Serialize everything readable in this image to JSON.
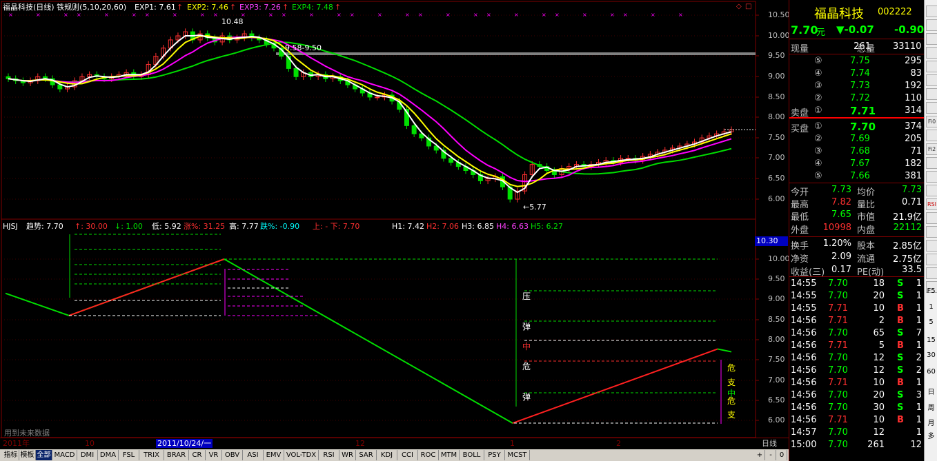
{
  "main_header": {
    "title": "福晶科技(日线) 铁规则(5,10,20,60)",
    "exp1": "EXP1: 7.61",
    "exp2": "EXP2: 7.46",
    "exp3": "EXP3: 7.26",
    "exp4": "EXP4: 7.48",
    "arrow_up": "↑"
  },
  "annotations": {
    "high": "10.48",
    "low": "←5.77",
    "resistance": "9.58-9.50",
    "no_future": "用到未来数据"
  },
  "yaxis_top": [
    "10.50",
    "10.00",
    "9.50",
    "9.00",
    "8.50",
    "8.00",
    "7.50",
    "7.00",
    "6.50",
    "6.00"
  ],
  "sub_header": {
    "name": "HJSJ",
    "trend": "趋势: 7.70",
    "t": "↑: 30.00",
    "l": "↓: 1.00",
    "low": "低: 5.92",
    "zhang": "涨%: 31.25",
    "high": "高: 7.77",
    "die": "跌%: -0.90",
    "updown": "上: - 下: 7.70",
    "h1": "H1: 7.42",
    "h2": "H2: 7.06",
    "h3": "H3: 6.85",
    "h4": "H4: 6.63",
    "h5": "H5: 6.27"
  },
  "yaxis_bottom": [
    "10.00",
    "9.50",
    "9.00",
    "8.50",
    "8.00",
    "7.50",
    "7.00",
    "6.50",
    "6.00"
  ],
  "sub_price_box": "10.30",
  "sub_zone_labels": {
    "ya": "压",
    "tan1": "弹",
    "zhong": "中",
    "wei": "危",
    "tan2": "弹"
  },
  "sub_right_labels": [
    "危",
    "支",
    "中",
    "危",
    "支"
  ],
  "date_axis": {
    "year": "2011年",
    "m10": "10",
    "cursor": "2011/10/24/一",
    "m12": "12",
    "m1": "1",
    "m2": "2",
    "period": "日线"
  },
  "bottom_tabs": [
    "指标",
    "模板",
    "全部",
    "MACD",
    "DMI",
    "DMA",
    "FSL",
    "TRIX",
    "BRAR",
    "CR",
    "VR",
    "OBV",
    "ASI",
    "EMV",
    "VOL-TDX",
    "RSI",
    "WR",
    "SAR",
    "KDJ",
    "CCI",
    "ROC",
    "MTM",
    "BOLL",
    "PSY",
    "MCST"
  ],
  "quote": {
    "name": "福晶科技",
    "code": "002222",
    "price": "7.70",
    "unit": "元",
    "change": "▼-0.07",
    "pct": "-0.90",
    "xianliang_label": "现量",
    "xianliang": "261",
    "zongliang_label": "总量",
    "zongliang": "33110",
    "sell_label": "卖盘",
    "buy_label": "买盘",
    "asks": [
      {
        "lvl": "⑤",
        "price": "7.75",
        "vol": "295"
      },
      {
        "lvl": "④",
        "price": "7.74",
        "vol": "83"
      },
      {
        "lvl": "③",
        "price": "7.73",
        "vol": "192"
      },
      {
        "lvl": "②",
        "price": "7.72",
        "vol": "110"
      },
      {
        "lvl": "①",
        "price": "7.71",
        "vol": "314"
      }
    ],
    "bids": [
      {
        "lvl": "①",
        "price": "7.70",
        "vol": "374"
      },
      {
        "lvl": "②",
        "price": "7.69",
        "vol": "205"
      },
      {
        "lvl": "③",
        "price": "7.68",
        "vol": "71"
      },
      {
        "lvl": "④",
        "price": "7.67",
        "vol": "182"
      },
      {
        "lvl": "⑤",
        "price": "7.66",
        "vol": "381"
      }
    ],
    "stats": [
      {
        "l1": "今开",
        "v1": "7.73",
        "l2": "均价",
        "v2": "7.73"
      },
      {
        "l1": "最高",
        "v1": "7.82",
        "l2": "量比",
        "v2": "0.71"
      },
      {
        "l1": "最低",
        "v1": "7.65",
        "l2": "市值",
        "v2": "21.9亿"
      },
      {
        "l1": "外盘",
        "v1": "10998",
        "l2": "内盘",
        "v2": "22112"
      },
      {
        "l1": "换手",
        "v1": "1.20%",
        "l2": "股本",
        "v2": "2.85亿"
      },
      {
        "l1": "净资",
        "v1": "2.09",
        "l2": "流通",
        "v2": "2.75亿"
      },
      {
        "l1": "收益(三)",
        "v1": "0.17",
        "l2": "PE(动)",
        "v2": "33.5"
      }
    ],
    "ticks": [
      {
        "t": "14:55",
        "p": "7.70",
        "v": "18",
        "s": "S",
        "n": "1"
      },
      {
        "t": "14:55",
        "p": "7.70",
        "v": "20",
        "s": "S",
        "n": "1"
      },
      {
        "t": "14:55",
        "p": "7.71",
        "v": "10",
        "s": "B",
        "n": "1"
      },
      {
        "t": "14:56",
        "p": "7.71",
        "v": "2",
        "s": "B",
        "n": "1"
      },
      {
        "t": "14:56",
        "p": "7.70",
        "v": "65",
        "s": "S",
        "n": "7"
      },
      {
        "t": "14:56",
        "p": "7.71",
        "v": "5",
        "s": "B",
        "n": "1"
      },
      {
        "t": "14:56",
        "p": "7.70",
        "v": "12",
        "s": "S",
        "n": "2"
      },
      {
        "t": "14:56",
        "p": "7.70",
        "v": "12",
        "s": "S",
        "n": "2"
      },
      {
        "t": "14:56",
        "p": "7.71",
        "v": "10",
        "s": "B",
        "n": "1"
      },
      {
        "t": "14:56",
        "p": "7.70",
        "v": "20",
        "s": "S",
        "n": "3"
      },
      {
        "t": "14:56",
        "p": "7.70",
        "v": "30",
        "s": "S",
        "n": "1"
      },
      {
        "t": "14:56",
        "p": "7.71",
        "v": "10",
        "s": "B",
        "n": "1"
      },
      {
        "t": "14:57",
        "p": "7.70",
        "v": "12",
        "s": "",
        "n": "1"
      },
      {
        "t": "15:00",
        "p": "7.70",
        "v": "261",
        "s": "",
        "n": "12"
      }
    ]
  },
  "toolbar_text": [
    "F5",
    "1",
    "5",
    "15",
    "30",
    "60",
    "日",
    "周",
    "月",
    "多"
  ],
  "toolbar_icons": [
    "Fi0",
    "Fi2",
    "RSI"
  ]
}
